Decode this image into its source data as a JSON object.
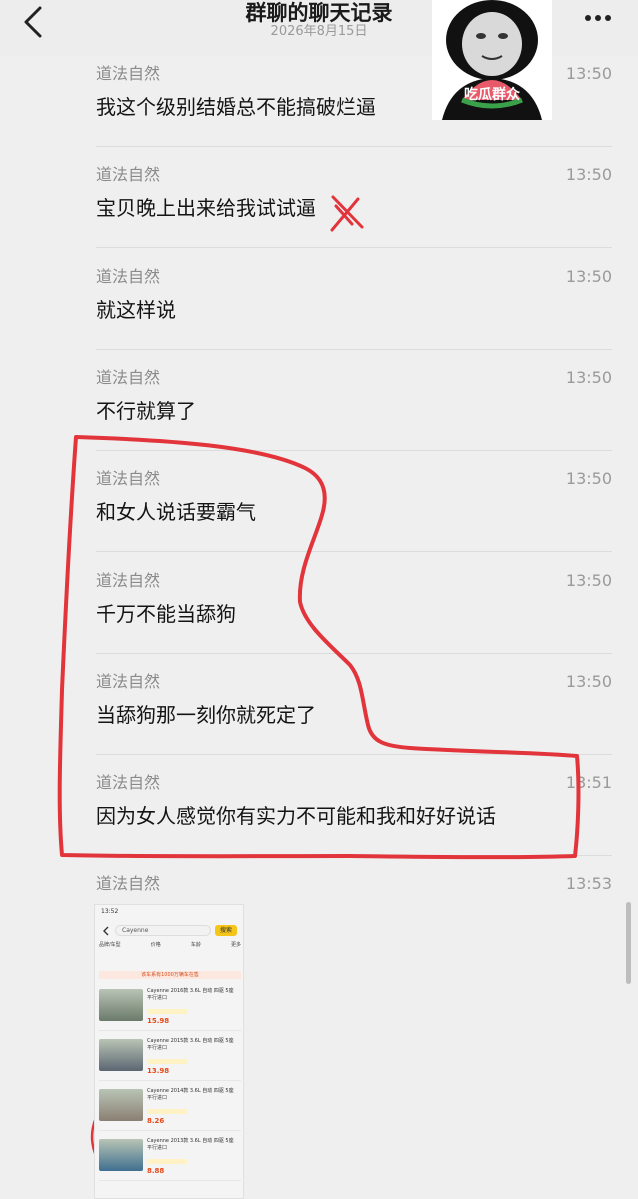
{
  "header": {
    "title": "群聊的聊天记录",
    "date": "2026年8月15日"
  },
  "meme": {
    "caption": "吃瓜群众"
  },
  "messages": [
    {
      "name": "道法自然",
      "time": "13:50",
      "text": "我这个级别结婚总不能搞破烂逼"
    },
    {
      "name": "道法自然",
      "time": "13:50",
      "text": "宝贝晚上出来给我试试逼"
    },
    {
      "name": "道法自然",
      "time": "13:50",
      "text": "就这样说"
    },
    {
      "name": "道法自然",
      "time": "13:50",
      "text": "不行就算了"
    },
    {
      "name": "道法自然",
      "time": "13:50",
      "text": "和女人说话要霸气"
    },
    {
      "name": "道法自然",
      "time": "13:50",
      "text": "千万不能当舔狗"
    },
    {
      "name": "道法自然",
      "time": "13:50",
      "text": "当舔狗那一刻你就死定了"
    },
    {
      "name": "道法自然",
      "time": "13:51",
      "text": "因为女人感觉你有实力不可能和我和好好说话"
    },
    {
      "name": "道法自然",
      "time": "13:53",
      "text": ""
    }
  ],
  "shared_image": {
    "status_time": "13:52",
    "search_text": "Cayenne",
    "search_button": "搜索",
    "filters": [
      "品牌/车型",
      "价格",
      "车龄",
      "更多"
    ],
    "banner": "该车系有1000万辆车在售",
    "listings": [
      {
        "title": "Cayenne 2016款 3.6L 自动 四驱 5座 平行进口",
        "price": "15.98"
      },
      {
        "title": "Cayenne 2015款 3.6L 自动 四驱 5座 平行进口",
        "price": "13.98"
      },
      {
        "title": "Cayenne 2014款 3.6L 自动 四驱 5座 平行进口",
        "price": "8.26"
      },
      {
        "title": "Cayenne 2013款 3.6L 自动 四驱 5座 平行进口",
        "price": "8.88"
      }
    ],
    "accent_color": "#f5c518",
    "price_color": "#e64a19"
  },
  "colors": {
    "annotation": "#e2343b",
    "background": "#efefef"
  }
}
